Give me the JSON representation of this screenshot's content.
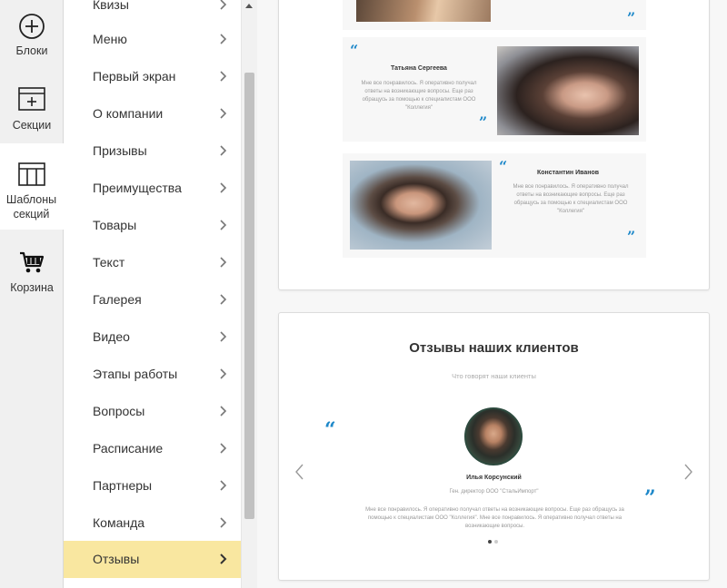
{
  "rail": {
    "items": [
      {
        "label": "Блоки"
      },
      {
        "label": "Секции"
      },
      {
        "label": "Шаблоны секций"
      },
      {
        "label": "Корзина"
      }
    ]
  },
  "menu": {
    "items": [
      {
        "label": "Квизы"
      },
      {
        "label": "Меню"
      },
      {
        "label": "Первый экран"
      },
      {
        "label": "О компании"
      },
      {
        "label": "Призывы"
      },
      {
        "label": "Преимущества"
      },
      {
        "label": "Товары"
      },
      {
        "label": "Текст"
      },
      {
        "label": "Галерея"
      },
      {
        "label": "Видео"
      },
      {
        "label": "Этапы работы"
      },
      {
        "label": "Вопросы"
      },
      {
        "label": "Расписание"
      },
      {
        "label": "Партнеры"
      },
      {
        "label": "Команда"
      },
      {
        "label": "Отзывы"
      }
    ],
    "active": "Отзывы"
  },
  "template1": {
    "reviews": [
      {
        "name": "Татьяна Сергеева",
        "text": "Мне все понравилось. Я оперативно получал ответы на возникающие вопросы. Еще раз обращусь за помощью к специалистам ООО \"Коллегия\""
      },
      {
        "name": "Константин Иванов",
        "text": "Мне все понравилось. Я оперативно получал ответы на возникающие вопросы. Еще раз обращусь за помощью к специалистам ООО \"Коллегия\""
      }
    ],
    "quote_open": "“",
    "quote_close": "”"
  },
  "template2": {
    "title": "Отзывы наших клиентов",
    "subtitle": "Что говорят наши клиенты",
    "review": {
      "name": "Илья Корсунский",
      "position": "Ген. директор ООО \"СтальИмпорт\"",
      "text": "Мне все понравилось. Я оперативно получал ответы на возникающие вопросы. Еще раз обращусь за помощью к специалистам ООО \"Коллегия\". Мне все понравилось. Я оперативно получал ответы на возникающие вопросы."
    },
    "quote_open": "“",
    "quote_close": "”"
  },
  "colors": {
    "accent": "#1e88c9",
    "active_menu": "#f9e7a0"
  }
}
